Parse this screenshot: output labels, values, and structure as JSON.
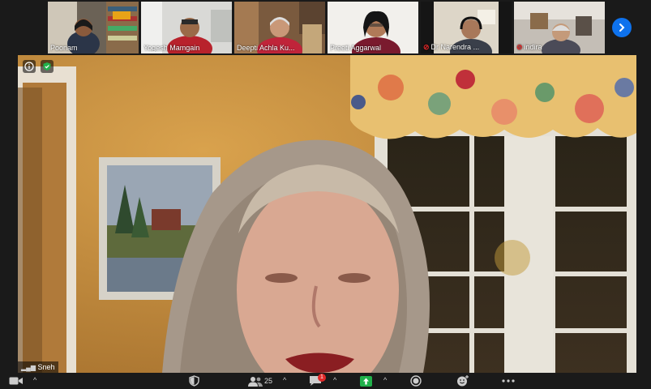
{
  "gallery": {
    "participants": [
      {
        "name": "Poonam",
        "muted": false
      },
      {
        "name": "Yogesh Mamgain",
        "muted": false
      },
      {
        "name": "Deepti Achla Ku...",
        "muted": false
      },
      {
        "name": "Preeti Aggarwal",
        "muted": false
      },
      {
        "name": "Dr Narendra ...",
        "muted": true
      },
      {
        "name": "indira",
        "muted": true
      }
    ],
    "next_icon": "chevron-right-icon"
  },
  "main_video": {
    "speaker_name": "Sneh",
    "info_icon": "info-icon",
    "security_icon": "shield-check-icon"
  },
  "toolbar": {
    "participants_count": "25",
    "chat_badge": "1",
    "colors": {
      "accent": "#0e72ed",
      "share": "#21b14b",
      "alert": "#e02828"
    }
  }
}
